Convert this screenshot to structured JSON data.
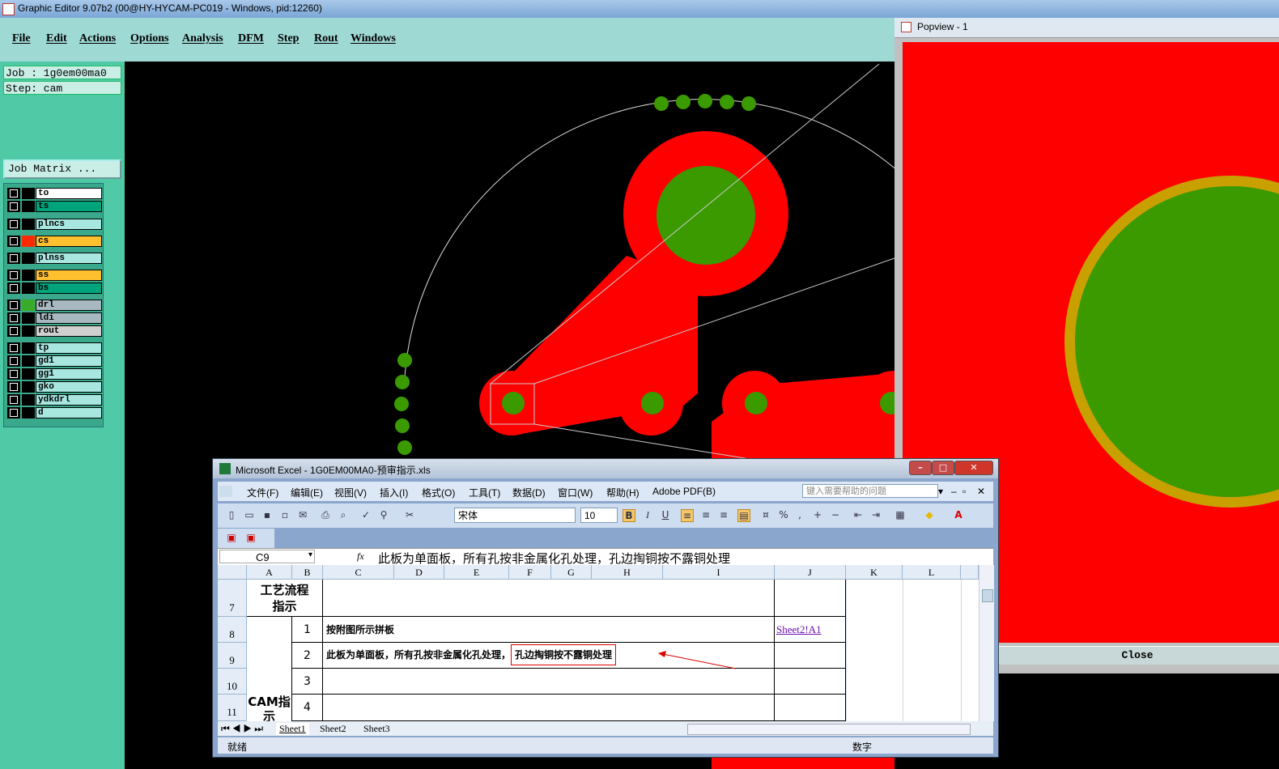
{
  "app": {
    "title": "Graphic Editor 9.07b2 (00@HY-HYCAM-PC019 - Windows, pid:12260)"
  },
  "menu": [
    "File",
    "Edit",
    "Actions",
    "Options",
    "Analysis",
    "DFM",
    "Step",
    "Rout",
    "Windows"
  ],
  "job_info": {
    "job": "Job : 1g0em00ma0",
    "step": "Step: cam",
    "job_matrix": "Job Matrix ..."
  },
  "layers": [
    {
      "name": "to",
      "color": "#000000",
      "bg": "#ffffff"
    },
    {
      "name": "ts",
      "color": "#000000",
      "bg": "#00a37a"
    },
    {
      "name": "plncs",
      "color": "#000000",
      "bg": "#a8e6e0"
    },
    {
      "name": "cs",
      "color": "#ff2a00",
      "bg": "#ffc030"
    },
    {
      "name": "plnss",
      "color": "#000000",
      "bg": "#a8e6e0"
    },
    {
      "name": "ss",
      "color": "#000000",
      "bg": "#ffc030"
    },
    {
      "name": "bs",
      "color": "#000000",
      "bg": "#00a37a"
    },
    {
      "name": "drl",
      "color": "#3aaa2a",
      "bg": "#a8b8c0"
    },
    {
      "name": "ldi",
      "color": "#000000",
      "bg": "#a8b8c0"
    },
    {
      "name": "rout",
      "color": "#000000",
      "bg": "#d0d0d0"
    },
    {
      "name": "tp",
      "color": "#000000",
      "bg": "#a8e6e0"
    },
    {
      "name": "gd1",
      "color": "#000000",
      "bg": "#a8e6e0"
    },
    {
      "name": "gg1",
      "color": "#000000",
      "bg": "#a8e6e0"
    },
    {
      "name": "gko",
      "color": "#000000",
      "bg": "#a8e6e0"
    },
    {
      "name": "ydkdrl",
      "color": "#000000",
      "bg": "#a8e6e0"
    },
    {
      "name": "d",
      "color": "#000000",
      "bg": "#a8e6e0"
    }
  ],
  "popview": {
    "title": "Popview - 1",
    "close_label": "Close"
  },
  "excel": {
    "title": "Microsoft Excel - 1G0EM00MA0-预审指示.xls",
    "menu": [
      "文件(F)",
      "编辑(E)",
      "视图(V)",
      "插入(I)",
      "格式(O)",
      "工具(T)",
      "数据(D)",
      "窗口(W)",
      "帮助(H)",
      "Adobe PDF(B)"
    ],
    "help_placeholder": "键入需要帮助的问题",
    "font_name": "宋体",
    "font_size": "10",
    "name_box": "C9",
    "fx": "fx",
    "formula": "此板为单面板，所有孔按非金属化孔处理，孔边掏铜按不露铜处理",
    "columns": [
      "A",
      "B",
      "C",
      "D",
      "E",
      "F",
      "G",
      "H",
      "I",
      "J",
      "K",
      "L"
    ],
    "rows": [
      "7",
      "8",
      "9",
      "10",
      "11"
    ],
    "cells": {
      "a7": "工艺流程指示",
      "a_cam": "CAM指示",
      "b8": "1",
      "b9": "2",
      "b10": "3",
      "b11": "4",
      "c8": "按附图所示拼板",
      "c9_part1": "此板为单面板，所有孔按非金属化孔处理，",
      "c9_part2": "孔边掏铜按不露铜处理",
      "j8": "Sheet2!A1"
    },
    "sheets": [
      "Sheet1",
      "Sheet2",
      "Sheet3"
    ],
    "status_left": "就绪",
    "status_right": "数字"
  }
}
